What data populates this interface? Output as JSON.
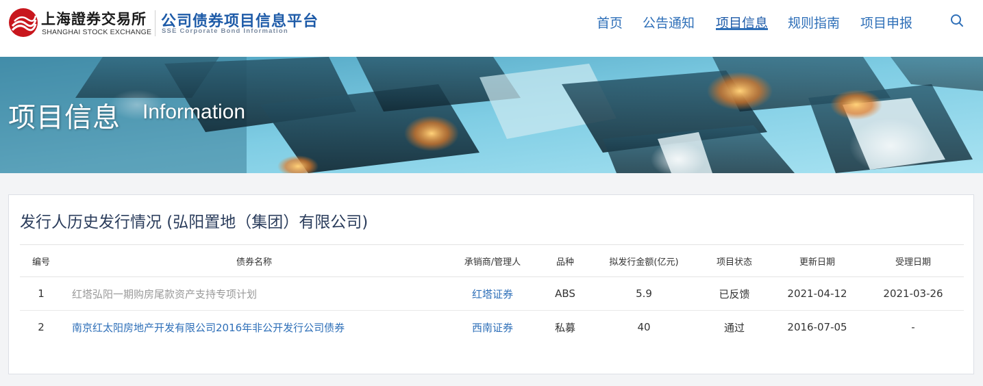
{
  "header": {
    "logo_cn": "上海證券交易所",
    "logo_en": "SHANGHAI STOCK EXCHANGE",
    "platform_cn": "公司债券项目信息平台",
    "platform_en": "SSE Corporate Bond Information",
    "nav": [
      {
        "label": "首页",
        "active": false
      },
      {
        "label": "公告通知",
        "active": false
      },
      {
        "label": "项目信息",
        "active": true
      },
      {
        "label": "规则指南",
        "active": false
      },
      {
        "label": "项目申报",
        "active": false
      }
    ],
    "search_icon": "search-icon"
  },
  "banner": {
    "title": "项目信息",
    "subtitle": "Information"
  },
  "section": {
    "title": "发行人历史发行情况 (弘阳置地（集团）有限公司)",
    "columns": [
      "编号",
      "债券名称",
      "承销商/管理人",
      "品种",
      "拟发行金额(亿元)",
      "项目状态",
      "更新日期",
      "受理日期"
    ],
    "rows": [
      {
        "no": "1",
        "name": "红塔弘阳一期购房尾款资产支持专项计划",
        "underwriter": "红塔证券",
        "type": "ABS",
        "amount": "5.9",
        "status": "已反馈",
        "updated": "2021-04-12",
        "accepted": "2021-03-26"
      },
      {
        "no": "2",
        "name": "南京红太阳房地产开发有限公司2016年非公开发行公司债券",
        "underwriter": "西南证券",
        "type": "私募",
        "amount": "40",
        "status": "通过",
        "updated": "2016-07-05",
        "accepted": "-"
      }
    ]
  },
  "colors": {
    "brand_blue": "#1e5ba8",
    "nav_blue": "#2e6fb8",
    "logo_red": "#c8161d",
    "muted_text": "#999999"
  }
}
